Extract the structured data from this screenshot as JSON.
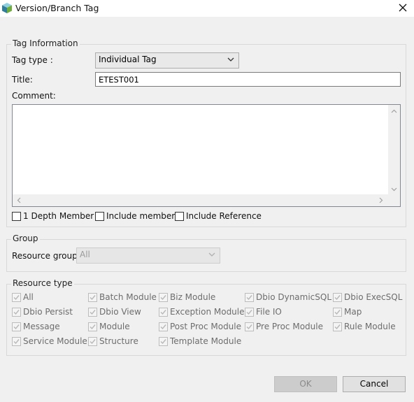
{
  "window": {
    "title": "Version/Branch Tag"
  },
  "tag_info": {
    "legend": "Tag Information",
    "tag_type_label": "Tag type :",
    "tag_type_value": "Individual Tag",
    "title_label": "Title:",
    "title_value": "ETEST001",
    "comment_label": "Comment:",
    "comment_value": "",
    "options": [
      {
        "label": "1 Depth Member",
        "checked": false
      },
      {
        "label": "Include member",
        "checked": false
      },
      {
        "label": "Include Reference",
        "checked": false
      }
    ]
  },
  "group": {
    "legend": "Group",
    "resource_group_label": "Resource group:",
    "resource_group_value": "All"
  },
  "resource_type": {
    "legend": "Resource type",
    "items": [
      {
        "label": "All",
        "checked": true
      },
      {
        "label": "Batch Module",
        "checked": true
      },
      {
        "label": "Biz Module",
        "checked": true
      },
      {
        "label": "Dbio DynamicSQL",
        "checked": true
      },
      {
        "label": "Dbio ExecSQL",
        "checked": true
      },
      {
        "label": "Dbio Persist",
        "checked": true
      },
      {
        "label": "Dbio View",
        "checked": true
      },
      {
        "label": "Exception Module",
        "checked": true
      },
      {
        "label": "File IO",
        "checked": true
      },
      {
        "label": "Map",
        "checked": true
      },
      {
        "label": "Message",
        "checked": true
      },
      {
        "label": "Module",
        "checked": true
      },
      {
        "label": "Post Proc Module",
        "checked": true
      },
      {
        "label": "Pre Proc Module",
        "checked": true
      },
      {
        "label": "Rule Module",
        "checked": true
      },
      {
        "label": "Service Module",
        "checked": true
      },
      {
        "label": "Structure",
        "checked": true
      },
      {
        "label": "Template Module",
        "checked": true
      }
    ]
  },
  "buttons": {
    "ok": "OK",
    "cancel": "Cancel"
  }
}
